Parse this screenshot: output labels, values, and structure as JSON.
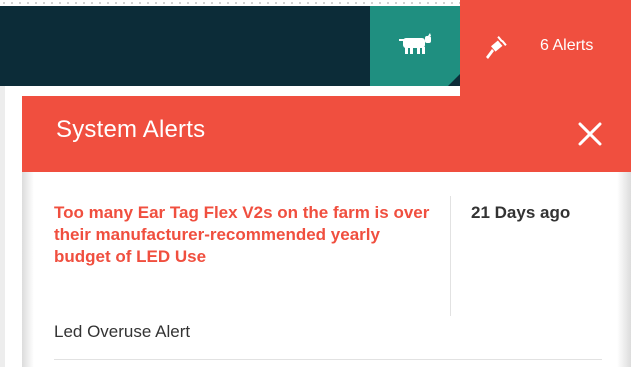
{
  "header": {
    "cow_icon": "cow-icon",
    "plug_icon": "plug-icon",
    "alerts_count_label": "6 Alerts",
    "colors": {
      "navbar": "#0c2c38",
      "cow_tab": "#1f8f80",
      "alert_accent": "#f04f3f"
    }
  },
  "panel": {
    "title": "System Alerts",
    "close_icon": "close-icon",
    "alerts": [
      {
        "message": "Too many Ear Tag Flex V2s on the farm is over their manufacturer-recommended yearly budget of LED Use",
        "time": "21 Days ago",
        "type": "Led Overuse Alert"
      }
    ]
  }
}
